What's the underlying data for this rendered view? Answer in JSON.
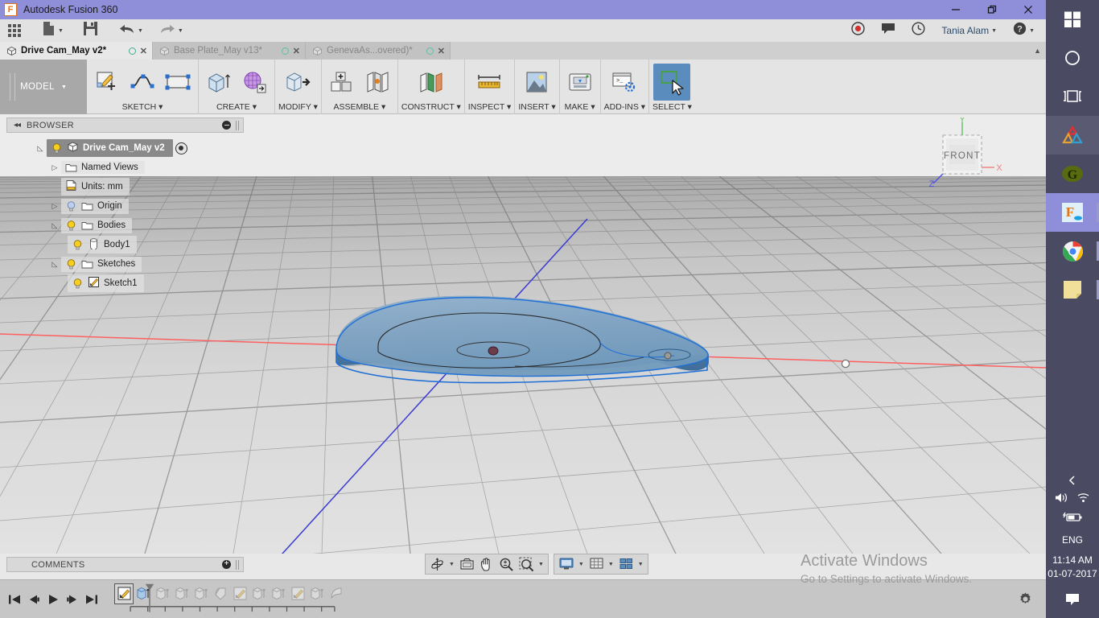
{
  "window": {
    "title": "Autodesk Fusion 360",
    "logo_letter": "F",
    "minimize": "—",
    "restore": "❐",
    "close": "✕"
  },
  "quick_access": {
    "app_grid": "app-grid",
    "new_label": "new-file",
    "save_label": "save",
    "undo_label": "undo",
    "redo_label": "redo",
    "record_label": "record",
    "comment_label": "comments",
    "history_label": "job-status",
    "user": "Tania Alam",
    "help": "?"
  },
  "tabs": [
    {
      "label": "Drive Cam_May v2*",
      "active": true
    },
    {
      "label": "Base Plate_May v13*",
      "active": false
    },
    {
      "label": "GenevaAs...overed)*",
      "active": false
    }
  ],
  "ribbon": {
    "workspace": "MODEL",
    "groups": [
      {
        "label": "SKETCH",
        "icons": [
          "create-sketch-icon",
          "spline-icon",
          "rectangle-icon"
        ]
      },
      {
        "label": "CREATE",
        "icons": [
          "extrude-icon",
          "create-form-icon"
        ]
      },
      {
        "label": "MODIFY",
        "icons": [
          "press-pull-icon"
        ]
      },
      {
        "label": "ASSEMBLE",
        "icons": [
          "new-component-icon",
          "joint-icon"
        ]
      },
      {
        "label": "CONSTRUCT",
        "icons": [
          "offset-plane-icon"
        ]
      },
      {
        "label": "INSPECT",
        "icons": [
          "measure-icon"
        ]
      },
      {
        "label": "INSERT",
        "icons": [
          "insert-image-icon"
        ]
      },
      {
        "label": "MAKE",
        "icons": [
          "3d-print-icon"
        ]
      },
      {
        "label": "ADD-INS",
        "icons": [
          "scripts-addins-icon"
        ]
      },
      {
        "label": "SELECT",
        "icons": [
          "select-window-icon"
        ],
        "selected": true
      }
    ]
  },
  "browser": {
    "header": "BROWSER",
    "collapse_icon": "collapse-left-icon",
    "items": [
      {
        "label": "Drive Cam_May v2",
        "indent": 0,
        "expander": "expanded",
        "bulb": true,
        "icon": "component-icon",
        "root": true,
        "target": true
      },
      {
        "label": "Named Views",
        "indent": 1,
        "expander": "collapsed",
        "bulb": false,
        "icon": "folder-icon"
      },
      {
        "label": "Units: mm",
        "indent": 1,
        "expander": "none",
        "bulb": false,
        "icon": "units-icon"
      },
      {
        "label": "Origin",
        "indent": 1,
        "expander": "collapsed",
        "bulb": true,
        "bulb_color": "blue",
        "icon": "folder-icon"
      },
      {
        "label": "Bodies",
        "indent": 1,
        "expander": "expanded",
        "bulb": true,
        "icon": "folder-icon"
      },
      {
        "label": "Body1",
        "indent": 2,
        "expander": "none",
        "bulb": true,
        "icon": "body-icon"
      },
      {
        "label": "Sketches",
        "indent": 1,
        "expander": "expanded",
        "bulb": true,
        "icon": "folder-icon"
      },
      {
        "label": "Sketch1",
        "indent": 2,
        "expander": "none",
        "bulb": true,
        "icon": "sketch-icon"
      }
    ]
  },
  "viewcube": {
    "face": "FRONT",
    "axis_x": "X",
    "axis_y": "Y",
    "axis_z": "Z",
    "color_x": "#f08080",
    "color_y": "#5ec25e",
    "color_z": "#5050e0"
  },
  "canvas": {
    "grid_color": "#8c8c8c",
    "x_axis_color": "#ff5a5a",
    "z_axis_color": "#3a3ad0",
    "body_color": "#7fa3c4",
    "body_edge_color": "#1a6fd4",
    "sky_color": "#ececec"
  },
  "navbar": {
    "buttons": [
      {
        "name": "orbit-icon",
        "caret": true
      },
      {
        "name": "look-at-icon",
        "caret": false
      },
      {
        "name": "pan-icon",
        "caret": false
      },
      {
        "name": "zoom-icon",
        "caret": false
      },
      {
        "name": "zoom-window-icon",
        "caret": true
      },
      {
        "name": "display-settings-icon",
        "caret": true
      },
      {
        "name": "grid-snaps-icon",
        "caret": true
      },
      {
        "name": "viewports-icon",
        "caret": true
      }
    ]
  },
  "comments": {
    "label": "COMMENTS",
    "add_icon": "add-comment-icon"
  },
  "timeline": {
    "playback": [
      "go-to-beginning-icon",
      "step-back-icon",
      "play-icon",
      "step-forward-icon",
      "go-to-end-icon"
    ],
    "features": [
      {
        "name": "sketch-icon",
        "active": true
      },
      {
        "name": "extrude-icon",
        "active": true
      },
      {
        "name": "extrude-icon",
        "active": false
      },
      {
        "name": "extrude-icon",
        "active": false
      },
      {
        "name": "extrude-icon",
        "active": false
      },
      {
        "name": "fillet-icon",
        "active": false
      },
      {
        "name": "sketch-icon",
        "active": false
      },
      {
        "name": "extrude-icon",
        "active": false
      },
      {
        "name": "extrude-icon",
        "active": false
      },
      {
        "name": "sketch-icon",
        "active": false
      },
      {
        "name": "extrude-icon",
        "active": false
      },
      {
        "name": "revolve-icon",
        "active": false
      }
    ],
    "settings_icon": "timeline-settings-icon"
  },
  "watermark": {
    "line1": "Activate Windows",
    "line2": "Go to Settings to activate Windows."
  },
  "taskbar": {
    "items": [
      {
        "name": "start-button",
        "label": "windows-logo-icon"
      },
      {
        "name": "cortana-button",
        "label": "cortana-icon"
      },
      {
        "name": "task-view-button",
        "label": "task-view-icon"
      },
      {
        "name": "autodesk-app",
        "label": "autodesk-icon"
      },
      {
        "name": "grammarly-app",
        "label": "g-app-icon"
      },
      {
        "name": "fusion360-app",
        "label": "fusion360-icon"
      },
      {
        "name": "chrome-app",
        "label": "chrome-icon"
      },
      {
        "name": "sticky-notes-app",
        "label": "sticky-notes-icon"
      }
    ],
    "tray": {
      "expand": "show-hidden-icons-icon",
      "volume": "volume-icon",
      "network": "wifi-icon",
      "battery": "battery-charging-icon",
      "language": "ENG",
      "time": "11:14 AM",
      "date": "01-07-2017",
      "action_center": "action-center-icon"
    }
  }
}
